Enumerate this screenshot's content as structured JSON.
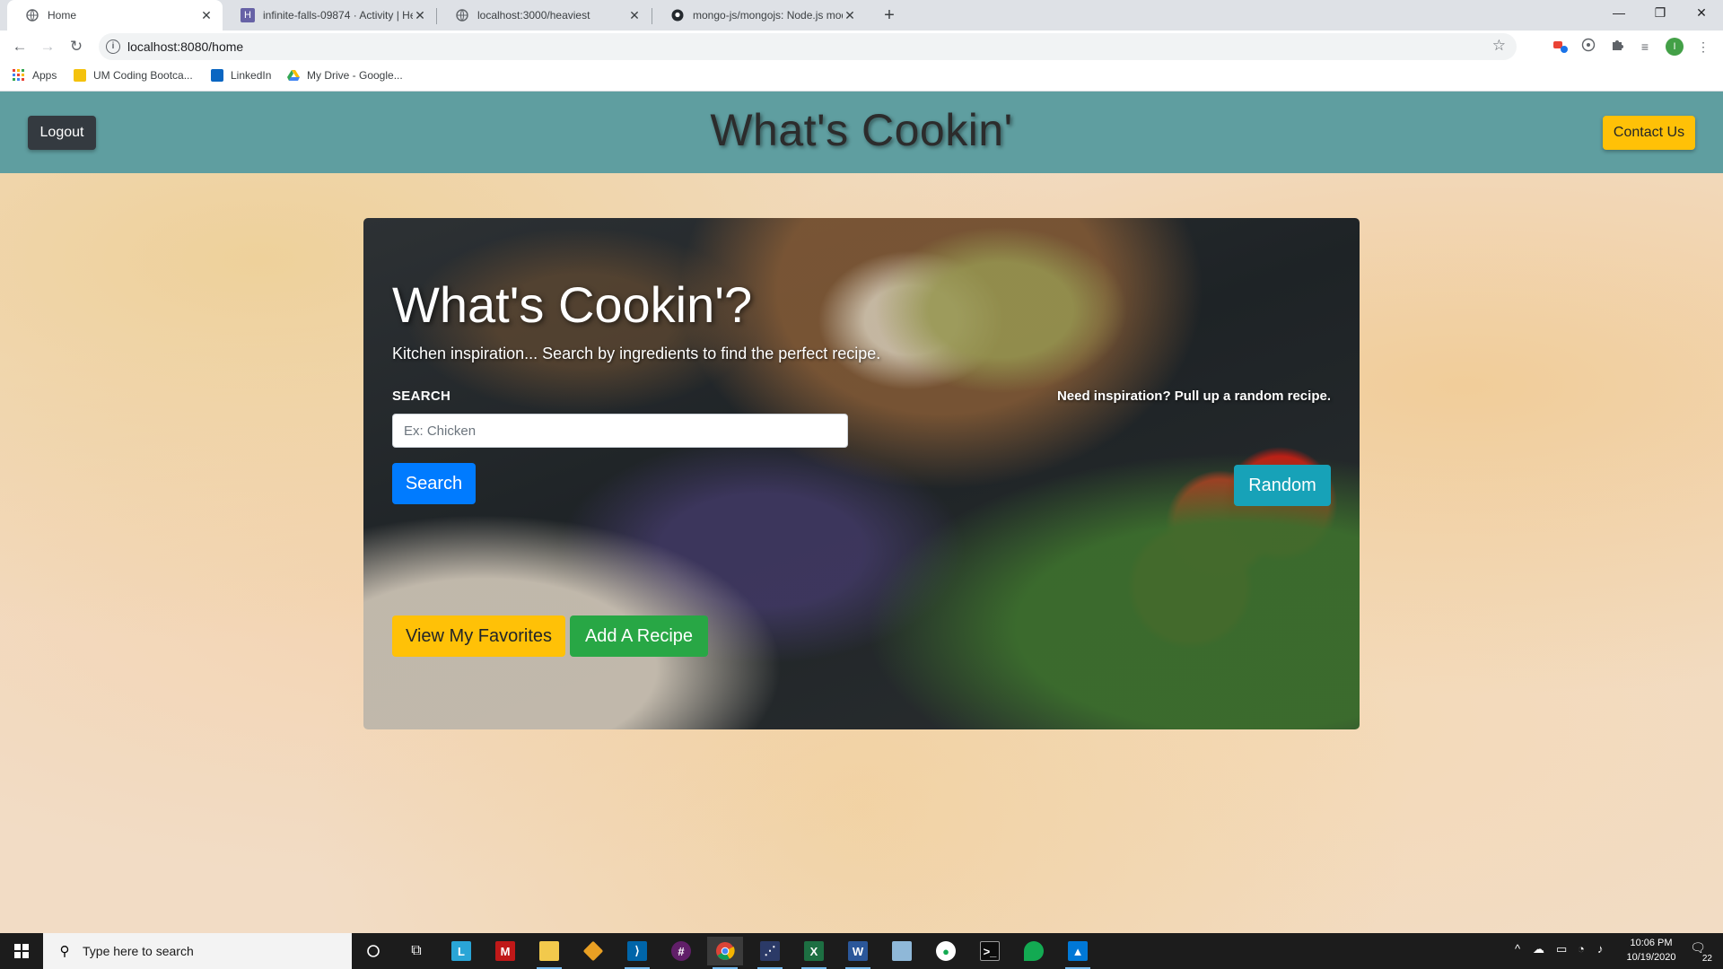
{
  "browser": {
    "tabs": [
      {
        "title": "Home",
        "active": true,
        "favicon": "globe-icon"
      },
      {
        "title": "infinite-falls-09874 · Activity | Her",
        "active": false,
        "favicon": "heroku-icon"
      },
      {
        "title": "localhost:3000/heaviest",
        "active": false,
        "favicon": "globe-icon"
      },
      {
        "title": "mongo-js/mongojs: Node.js mod",
        "active": false,
        "favicon": "github-icon"
      }
    ],
    "url": "localhost:8080/home",
    "profile_initial": "I",
    "bookmarks": [
      {
        "label": "Apps",
        "icon": "apps-grid-icon"
      },
      {
        "label": "UM Coding Bootca...",
        "icon": "folder-icon"
      },
      {
        "label": "LinkedIn",
        "icon": "linkedin-icon"
      },
      {
        "label": "My Drive - Google...",
        "icon": "google-drive-icon"
      }
    ]
  },
  "navbar": {
    "logout_label": "Logout",
    "brand": "What's Cookin'",
    "contact_label": "Contact Us",
    "bg_color": "#5f9ea0"
  },
  "hero": {
    "title": "What's Cookin'?",
    "lead": "Kitchen inspiration... Search by ingredients to find the perfect recipe.",
    "search_label": "SEARCH",
    "search_placeholder": "Ex: Chicken",
    "search_value": "",
    "random_label": "Need inspiration? Pull up a random recipe.",
    "search_button": "Search",
    "random_button": "Random",
    "favorites_button": "View My Favorites",
    "add_recipe_button": "Add A Recipe"
  },
  "colors": {
    "primary": "#007bff",
    "info": "#17a2b8",
    "warning": "#ffc107",
    "success": "#28a745",
    "dark": "#343a40"
  },
  "taskbar": {
    "search_placeholder": "Type here to search",
    "time": "10:06 PM",
    "date": "10/19/2020",
    "notification_count": "22"
  }
}
